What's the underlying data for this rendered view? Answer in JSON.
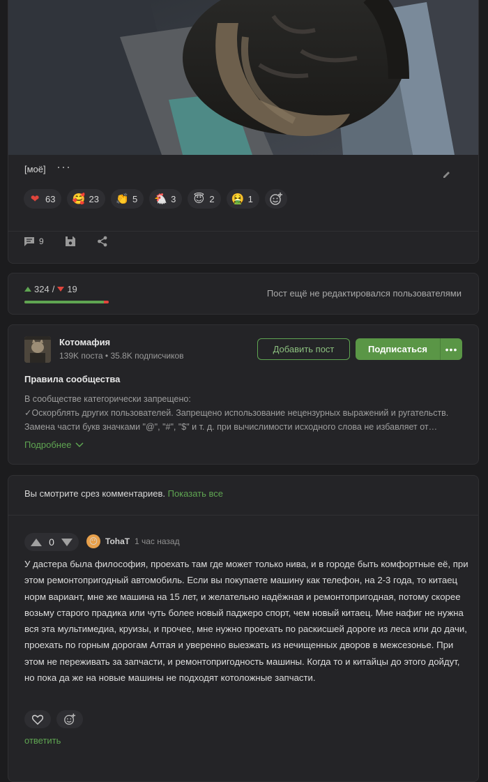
{
  "post": {
    "tag": "[моё]",
    "reactions": [
      {
        "emoji": "❤",
        "icon": "heart-icon",
        "count": "63"
      },
      {
        "emoji": "🥰",
        "icon": "smiling-hearts-icon",
        "count": "23"
      },
      {
        "emoji": "👏",
        "icon": "clapping-icon",
        "count": "5"
      },
      {
        "emoji": "🐔",
        "icon": "chicken-icon",
        "count": "3"
      },
      {
        "emoji": "😇",
        "icon": "halo-icon",
        "count": "2"
      },
      {
        "emoji": "🤮",
        "icon": "vomit-icon",
        "count": "1"
      }
    ],
    "comments_count": "9"
  },
  "rating": {
    "pluses": "324",
    "separator": "/",
    "minuses": "19",
    "positive_fraction": 0.945,
    "edit_note": "Пост ещё не редактировался пользователями"
  },
  "community": {
    "name": "Котомафия",
    "posts": "139K поста",
    "dot": "•",
    "subscribers": "35.8K подписчиков",
    "add_post_label": "Добавить пост",
    "subscribe_label": "Подписаться",
    "more_label": "•••",
    "rules_title": "Правила сообщества",
    "rules_line1": "В сообществе категорически запрещено:",
    "rules_line2": "✓Оскорблять других пользователей. Запрещено использование нецензурных выражений и ругательств.",
    "rules_line3": "Замена части букв значками \"@\", \"#\", \"$\" и т. д. при вычислимости исходного слова не избавляет от…",
    "more_link": "Подробнее"
  },
  "comments": {
    "slice_note": "Вы смотрите срез комментариев.",
    "show_all": "Показать все",
    "items": [
      {
        "score": "0",
        "avatar_emoji": "😶",
        "author": "TohaT",
        "time": "1 час назад",
        "text": "У дастера была философия, проехать там где может только нива, и в городе быть комфортные её, при этом ремонтопригодный автомобиль. Если вы покупаете машину как телефон, на 2-3 года, то китаец норм вариант, мне же машина на 15 лет, и желательно надёжная и ремонтопригодная, потому скорее возьму старого прадика или чуть более новый паджеро спорт, чем новый китаец. Мне нафиг не нужна вся эта мультимедиа, круизы, и прочее, мне нужно проехать по раскисшей дороге из леса или до дачи, проехать по горным дорогам Алтая и уверенно выезжать из нечищенных дворов в межсезонье. При этом не переживать за запчасти, и ремонтопригодность машины. Когда то и китайцы до этого дойдут, но пока да же на новые машины не подходят котоложные запчасти.",
        "reply_label": "ответить"
      }
    ]
  },
  "colors": {
    "accent": "#5fa552",
    "danger": "#e0453c",
    "card": "#242427",
    "background": "#1c1c1e"
  }
}
